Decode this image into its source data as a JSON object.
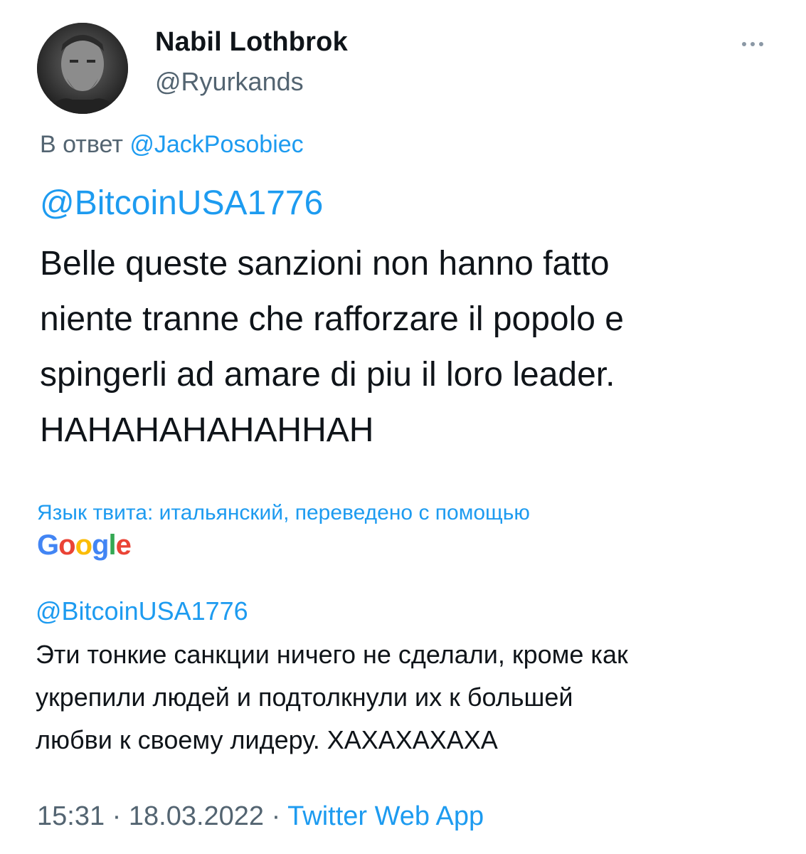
{
  "user": {
    "display_name": "Nabil Lothbrok",
    "handle": "@Ryurkands"
  },
  "reply": {
    "prefix": "В ответ",
    "to": "@JackPosobiec"
  },
  "tweet": {
    "mention": "@BitcoinUSA1776",
    "lines": [
      " Belle queste sanzioni non hanno fatto",
      "niente tranne che rafforzare il popolo e",
      "spingerli ad amare di piu il loro leader.",
      "HAHAHAHAHAHHAH"
    ]
  },
  "translation": {
    "note": "Язык твита: итальянский, переведено с помощью",
    "provider": "Google",
    "mention": "@BitcoinUSA1776",
    "lines": [
      " Эти тонкие санкции ничего не сделали, кроме как",
      "укрепили людей и подтолкнули их к большей",
      "любви к своему лидеру. ХАХАХАХАХА"
    ]
  },
  "meta": {
    "time": "15:31",
    "separator1": " · ",
    "date": "18.03.2022",
    "separator2": " · ",
    "app": "Twitter Web App"
  },
  "colors": {
    "link": "#1d9bf0",
    "secondary_text": "#536471",
    "primary_text": "#0f1419"
  },
  "icons": {
    "more": "more-dots-icon"
  }
}
